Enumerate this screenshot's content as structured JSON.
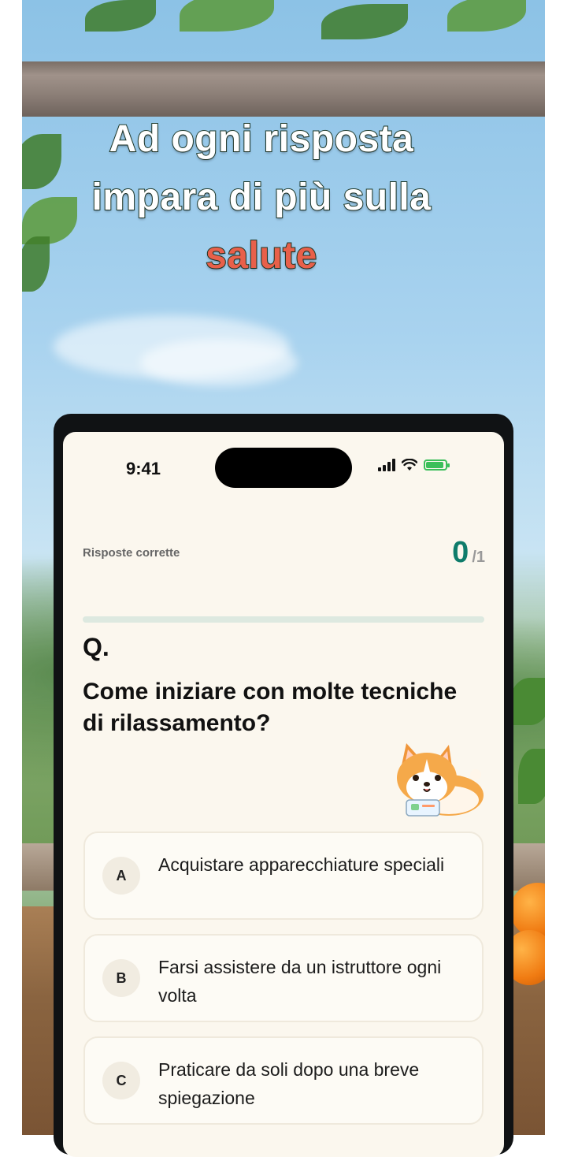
{
  "headline": {
    "line1": "Ad ogni risposta",
    "line2": "impara di più sulla",
    "line3": "salute"
  },
  "status_bar": {
    "time": "9:41"
  },
  "score": {
    "label": "Risposte corrette",
    "value": "0",
    "total": "/1"
  },
  "progress": {
    "fraction": 0
  },
  "question": {
    "marker": "Q.",
    "text": "Come iniziare con molte tecniche di rilassamento?"
  },
  "options": [
    {
      "letter": "A",
      "text": "Acquistare apparecchiature speciali"
    },
    {
      "letter": "B",
      "text": "Farsi assistere da un istruttore ogni volta"
    },
    {
      "letter": "C",
      "text": "Praticare da soli dopo una breve spiegazione"
    }
  ],
  "colors": {
    "accent_teal": "#0e7c6b",
    "headline_accent": "#e8604a",
    "screen_bg": "#fbf7ee"
  }
}
